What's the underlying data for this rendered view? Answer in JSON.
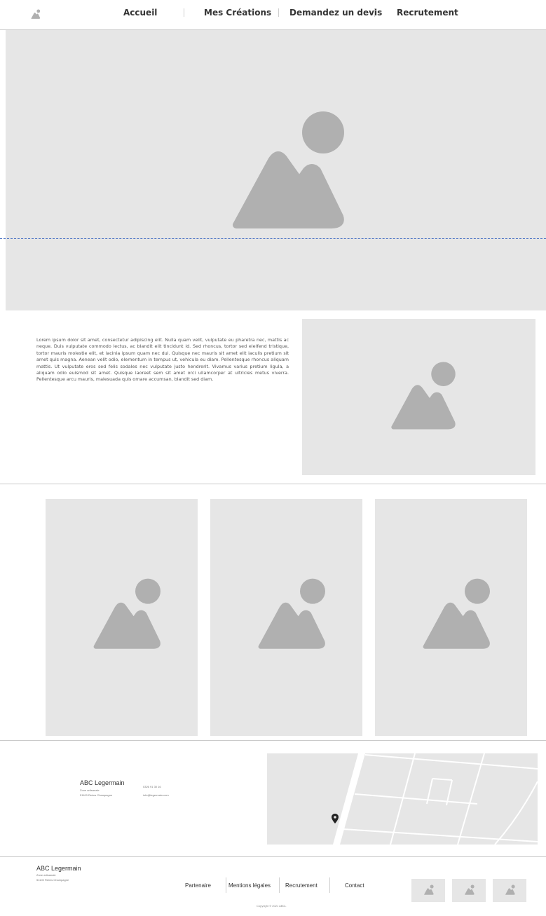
{
  "header": {
    "nav": [
      "Accueil",
      "Mes Créations",
      "Demandez un devis",
      "Recrutement"
    ]
  },
  "intro": {
    "text": "Lorem ipsum dolor sit amet, consectetur adipiscing elit. Nulla quam velit, vulputate eu pharetra nec, mattis ac neque. Duis vulputate commodo lectus, ac blandit elit tincidunt id. Sed rhoncus, tortor sed eleifend tristique, tortor mauris molestie elit, et lacinia ipsum quam nec dui. Quisque nec mauris sit amet elit iaculis pretium sit amet quis magna. Aenean velit odio, elementum in tempus ut, vehicula eu diam. Pellentesque rhoncus aliquam mattis. Ut vulputate eros sed felis sodales nec vulputate justo hendrerit. Vivamus varius pretium ligula, a aliquam odio euismod sit amet. Quisque laoreet sem sit amet orci ullamcorper at ultricies metus viverra. Pellentesque arcu mauris, malesuada quis ornare accumsan, blandit sed diam."
  },
  "contact": {
    "company": "ABC Legermain",
    "line1": "Zone artisanale",
    "line2": "51100 Reims Champagne",
    "phone": "0326 91 30 16",
    "email": "info@legermain.com"
  },
  "footer": {
    "company": "ABC Legermain",
    "line1": "Zone artisanale",
    "line2": "51100 Reims Champagne",
    "links": [
      "Partenaire",
      "Mentions légales",
      "Recrutement",
      "Contact"
    ],
    "copyright": "Copyright © 2021 ABCL"
  },
  "icons": {
    "logo": "image-placeholder-icon",
    "map_pin": "map-pin-icon"
  },
  "colors": {
    "placeholder_bg": "#e6e6e6",
    "placeholder_shape": "#b0b0b0",
    "guide_line": "#4a72c4"
  }
}
